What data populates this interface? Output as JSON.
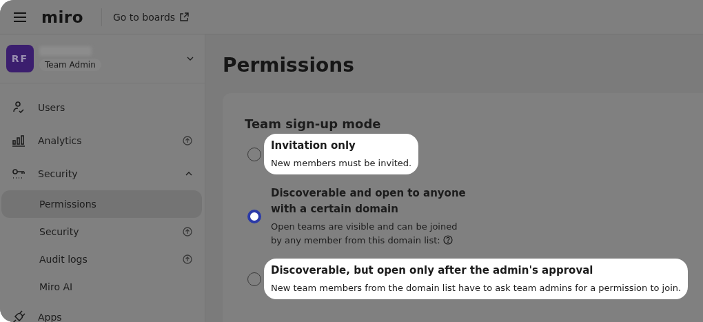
{
  "topbar": {
    "logo": "miro",
    "link": "Go to boards"
  },
  "team": {
    "initials": "RF",
    "role": "Team Admin"
  },
  "sidebar": {
    "items": [
      {
        "label": "Users",
        "upgrade": false
      },
      {
        "label": "Analytics",
        "upgrade": true
      },
      {
        "label": "Security",
        "upgrade": false,
        "expanded": true,
        "children": [
          {
            "label": "Permissions",
            "upgrade": false,
            "selected": true
          },
          {
            "label": "Security",
            "upgrade": true,
            "selected": false
          },
          {
            "label": "Audit logs",
            "upgrade": true,
            "selected": false
          },
          {
            "label": "Miro AI",
            "upgrade": false,
            "selected": false
          }
        ]
      },
      {
        "label": "Apps",
        "upgrade": false
      }
    ]
  },
  "page": {
    "title": "Permissions"
  },
  "signup": {
    "heading": "Team sign-up mode",
    "options": [
      {
        "title": "Invitation only",
        "description": "New members must be invited.",
        "selected": false,
        "highlighted": true,
        "help": false
      },
      {
        "title": "Discoverable and open to anyone with a certain domain",
        "description": "Open teams are visible and can be joined by any member from this domain list:",
        "selected": true,
        "highlighted": false,
        "help": true
      },
      {
        "title": "Discoverable, but open only after the admin's approval",
        "description": "New team members from the domain list have to ask team admins for a permission to join.",
        "selected": false,
        "highlighted": true,
        "help": false
      }
    ]
  }
}
